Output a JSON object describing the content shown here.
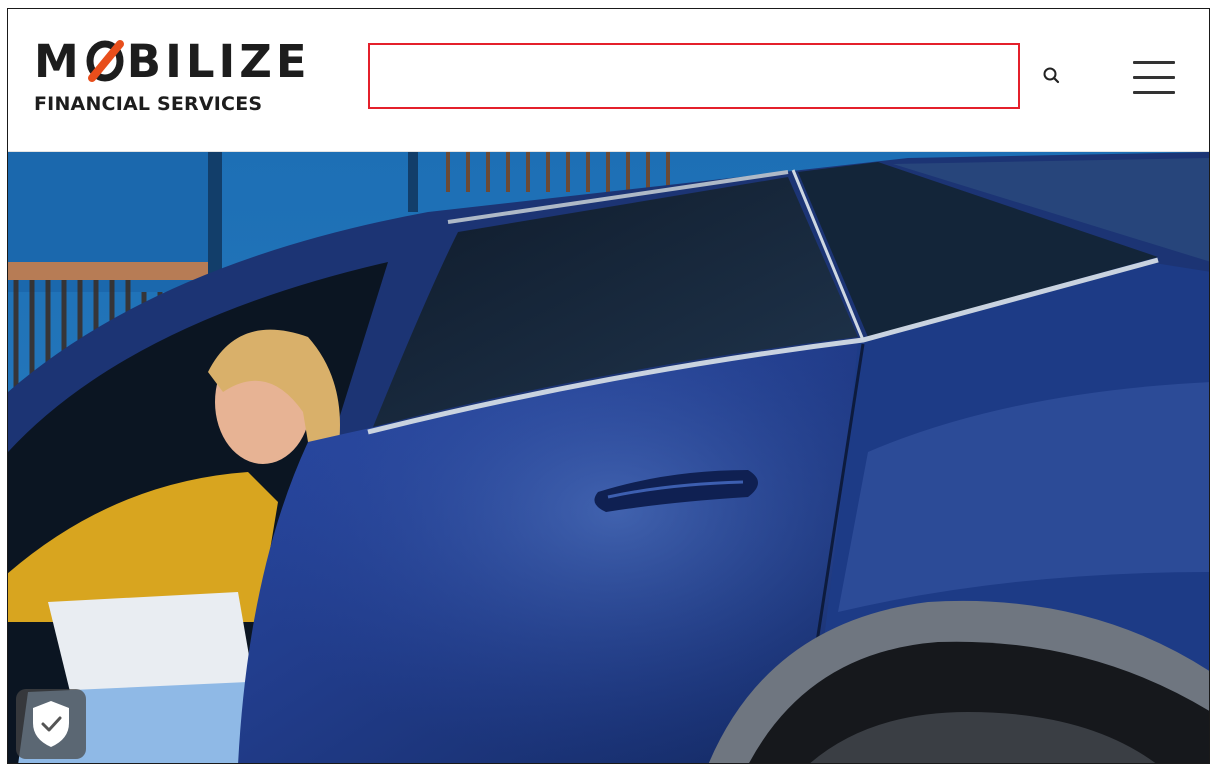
{
  "brand": {
    "name_left": "M",
    "name_right": "BILIZE",
    "subtitle": "FINANCIAL SERVICES",
    "accent_color": "#e84e1b"
  },
  "search": {
    "value": "",
    "placeholder": "",
    "border_color": "#e4202b",
    "button_icon": "search-icon"
  },
  "menu": {
    "icon": "hamburger-menu-icon"
  },
  "hero": {
    "image": "woman-in-yellow-shirt-getting-out-of-blue-car"
  },
  "trust_badge": {
    "icon": "shield-check-icon"
  }
}
